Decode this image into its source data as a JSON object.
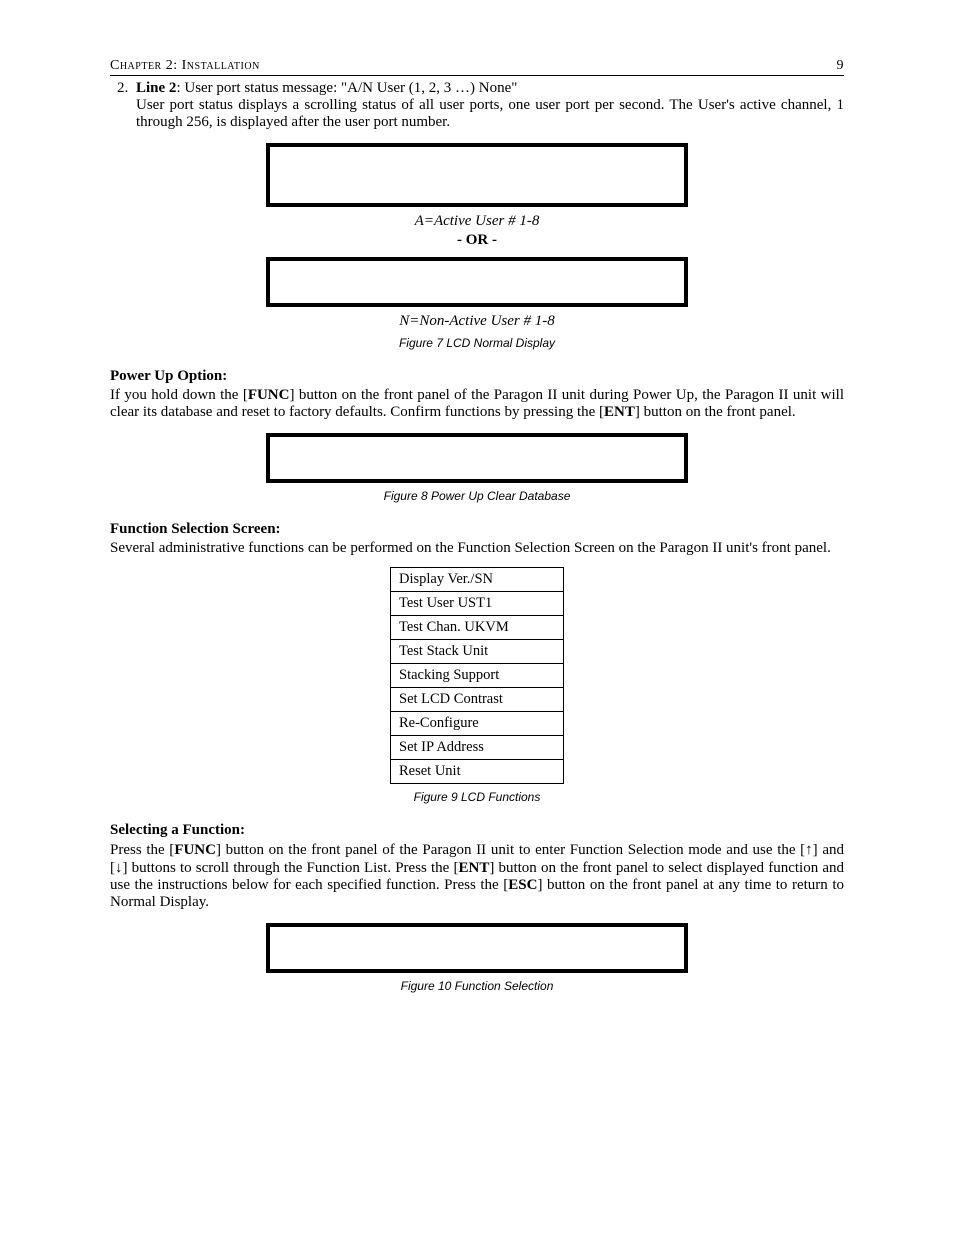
{
  "header": {
    "left": "Chapter 2: Installation",
    "right": "9"
  },
  "line2": {
    "number": "2.",
    "label": "Line 2",
    "intro_mid": ": User port status message: \"A/N User (1, 2, 3 …)    None\"",
    "detail": "User port status displays a scrolling status of all user ports, one user port per second. The User's active channel, 1 through 256, is displayed after the user port number."
  },
  "fig7": {
    "active_caption": "A=Active User  # 1-8",
    "or": "- OR -",
    "nonactive_caption": "N=Non-Active User # 1-8",
    "fig_caption": "Figure 7 LCD Normal Display"
  },
  "powerup": {
    "title": "Power Up Option:",
    "text_pre": "If you hold down the [",
    "func": "FUNC",
    "text_mid": "] button on the front panel of the Paragon II unit during Power Up, the Paragon II unit will clear its database and reset to factory defaults. Confirm functions by pressing the [",
    "ent": "ENT",
    "text_post": "] button on the front panel.",
    "fig_caption": "Figure 8 Power Up Clear Database"
  },
  "funcsel": {
    "title": "Function Selection Screen:",
    "text": "Several administrative functions can be performed on the Function Selection Screen on the Paragon II unit's front panel.",
    "items": [
      "Display Ver./SN",
      "Test User UST1",
      "Test Chan. UKVM",
      "Test Stack Unit",
      "Stacking Support",
      "Set LCD Contrast",
      "Re-Configure",
      "Set IP Address",
      "Reset Unit"
    ],
    "fig_caption": "Figure 9 LCD Functions"
  },
  "selecting": {
    "title": "Selecting a Function:",
    "p1": "Press the [",
    "func": "FUNC",
    "p2": "] button on the front panel of the Paragon II unit to enter Function Selection mode and use the [",
    "up": "↑",
    "p3": "] and [",
    "down": "↓",
    "p4": "] buttons to scroll through the Function List. Press the [",
    "ent": "ENT",
    "p5": "] button on the front panel to select displayed function and use the instructions below for each specified function. Press the [",
    "esc": "ESC",
    "p6": "] button on the front panel at any time to return to Normal Display.",
    "fig_caption": "Figure 10 Function Selection"
  }
}
